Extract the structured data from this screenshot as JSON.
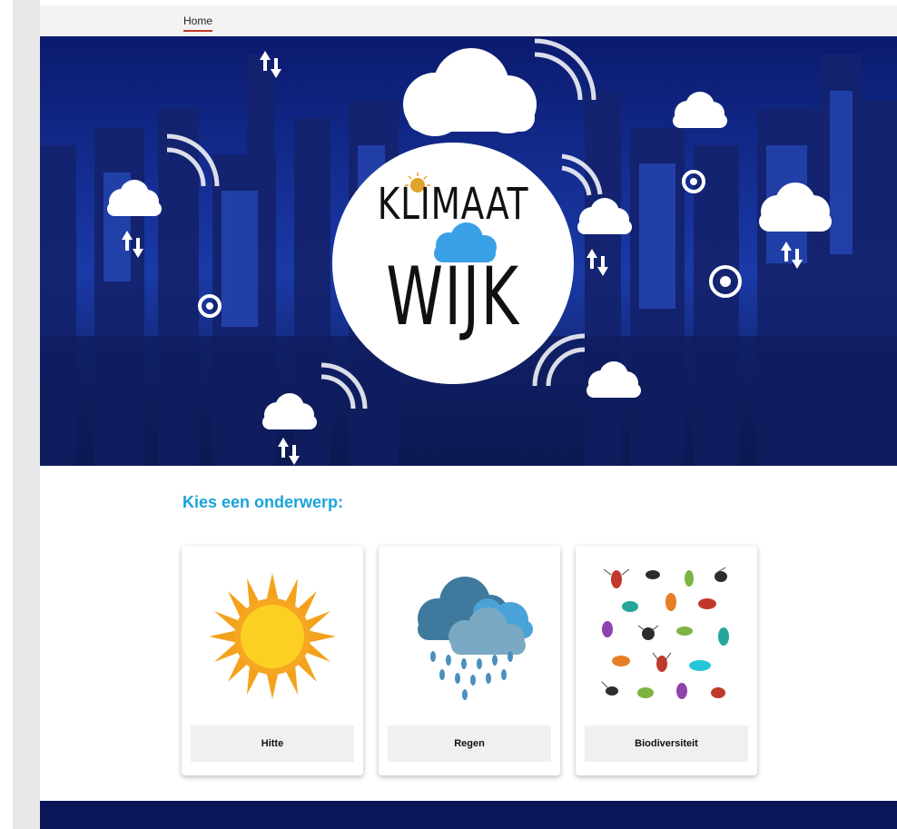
{
  "nav": {
    "home_label": "Home"
  },
  "hero": {
    "logo_top": "KLIMAAT",
    "logo_bottom": "WIJK"
  },
  "topics": {
    "heading": "Kies een onderwerp:",
    "cards": [
      {
        "label": "Hitte",
        "icon": "sun-icon"
      },
      {
        "label": "Regen",
        "icon": "rain-cloud-icon"
      },
      {
        "label": "Biodiversiteit",
        "icon": "insects-icon"
      }
    ]
  },
  "colors": {
    "accent": "#1aa3d9",
    "footer": "#0b1658",
    "nav_underline": "#c0392b"
  }
}
